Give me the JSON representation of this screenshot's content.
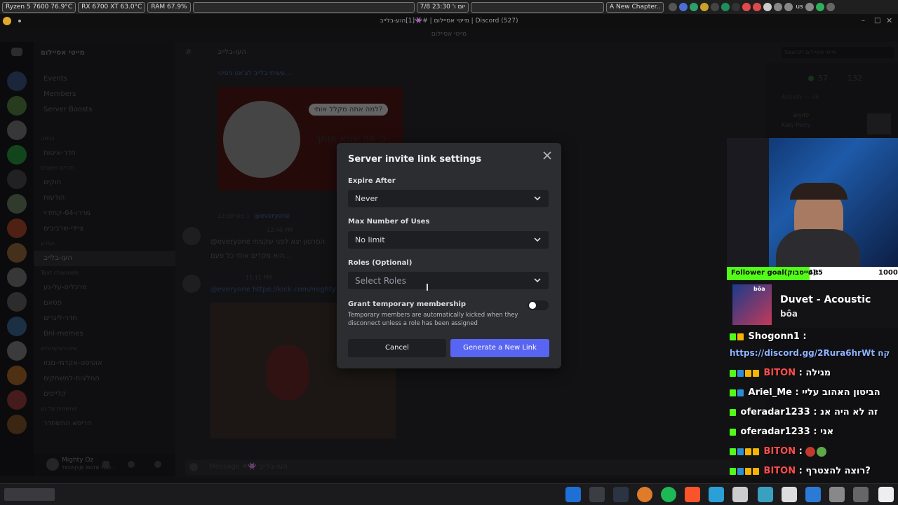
{
  "sysbar": {
    "cpu": "Ryzen 5 7600  76.9°C",
    "gpu": "RX 6700 XT 63.0°C",
    "ram": "RAM    67.9%",
    "clock": "7/8 יום ו' 23:30",
    "media": "A New Chapter..",
    "lang": "us"
  },
  "window": {
    "title": "מייטי אסיילום | #👾[1]הוע-בלייב | Discord (527)",
    "subtitle": "מייטי אסיילום"
  },
  "discord": {
    "server_name": "מייטי אסיילום",
    "channel_header": "העו-בלייב",
    "search_placeholder": "Search מייטי אסיילום",
    "top_items": [
      "Events",
      "Members",
      "Server Boosts"
    ],
    "sections": [
      {
        "title": "כניסה",
        "channels": [
          "חדר-איטות"
        ]
      },
      {
        "title": "חדרים חשובים",
        "channels": [
          "חוקים",
          "הודעות",
          "מררו-64-קתידוי",
          "ציידי-שרביבים"
        ]
      },
      {
        "title": "המדע",
        "channels": [
          "העו-בלייב"
        ]
      },
      {
        "title": "Text channels",
        "channels": [
          "מרכלים-על-נע",
          "פסאם",
          "חדר-ליגרים",
          "Bnl-memes"
        ]
      },
      {
        "title": "אינטראקטיביים",
        "channels": [
          "אוטיסט-אקדמי-מגזו",
          "המלצות-למשחקים",
          "קלייפים"
        ]
      },
      {
        "title": "שמשמים על נע",
        "channels": [
          "הריסא התשחדר"
        ]
      }
    ],
    "user": {
      "name": "Mighty Oz",
      "status": "TKDSJSJK MATB TBO..."
    },
    "message_placeholder": "Message #👾 העו-בלייב",
    "online_count": "57",
    "member_count": "132",
    "activity_label": "Activity — 34",
    "activity_user": "aryd0",
    "activity_detail": "Katy Perry",
    "meme_caption": "עשיתי בלייב לצ'אט גיפיטי...",
    "meme_text_1": "למה אתה מקלל אותי?",
    "meme_text_2": "כי אני שונא אותך",
    "msg1_time": "12:00ב מחר",
    "msg1_mention": "@everyone",
    "msg2_time": "12:40 PM",
    "msg2_text": "@everyone הסרטון יצא לפני שקמתי",
    "msg2_text_b": "הוא מקדים אותי כל פעם...",
    "msg3_time": "11:11 PM",
    "msg3_link": "@everyone https://kick.com/mighty"
  },
  "modal": {
    "title": "Server invite link settings",
    "expire_label": "Expire After",
    "expire_value": "Never",
    "max_uses_label": "Max Number of Uses",
    "max_uses_value": "No limit",
    "roles_label": "Roles (Optional)",
    "roles_placeholder": "Select Roles",
    "temp_label": "Grant temporary membership",
    "temp_desc": "Temporary members are automatically kicked when they disconnect unless a role has been assigned",
    "temp_enabled": false,
    "cancel_label": "Cancel",
    "generate_label": "Generate a New Link"
  },
  "stream": {
    "goal_label": "Follower goal(פייסבוק):",
    "goal_current": "485",
    "goal_target": "1000",
    "goal_progress": 0.485,
    "song_title": "Duvet - Acoustic",
    "song_artist": "bôa",
    "album_text": "bôa",
    "chat": [
      {
        "user": "Shogonn1",
        "msg": ":",
        "user_color": "#ffffff"
      },
      {
        "user": "",
        "msg": "https://discord.gg/2Rura6hrWt קח",
        "user_color": "#8fb3ff"
      },
      {
        "user": "BITON",
        "msg": ": מגילה",
        "user_color": "#ff4d4d"
      },
      {
        "user": "Ariel_Me",
        "msg": ": הביטון האהוב עליי",
        "user_color": "#ffffff"
      },
      {
        "user": "oferadar1233",
        "msg": ": זה לא היה אנ",
        "user_color": "#ffffff"
      },
      {
        "user": "oferadar1233",
        "msg": ": אני",
        "user_color": "#ffffff"
      },
      {
        "user": "BITON",
        "msg": ":",
        "user_color": "#ff4d4d"
      },
      {
        "user": "BITON",
        "msg": ": רוצה להצטרף?",
        "user_color": "#ff4d4d"
      }
    ]
  },
  "colors": {
    "accent": "#5865f2",
    "kick_green": "#53fc18",
    "modal_bg": "#2b2d31"
  }
}
